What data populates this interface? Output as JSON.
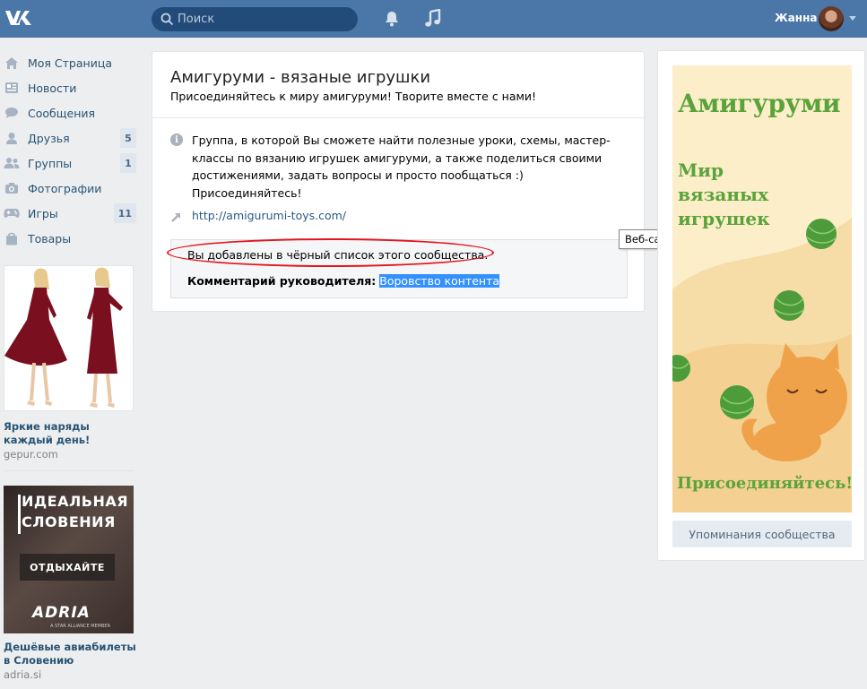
{
  "header": {
    "logo": "VK",
    "search_placeholder": "Поиск",
    "user_name": "Жанна"
  },
  "nav": {
    "items": [
      {
        "label": "Моя Страница",
        "icon": "home-icon"
      },
      {
        "label": "Новости",
        "icon": "news-icon"
      },
      {
        "label": "Сообщения",
        "icon": "messages-icon"
      },
      {
        "label": "Друзья",
        "icon": "friends-icon",
        "badge": "5"
      },
      {
        "label": "Группы",
        "icon": "groups-icon",
        "badge": "1"
      },
      {
        "label": "Фотографии",
        "icon": "camera-icon"
      },
      {
        "label": "Игры",
        "icon": "gamepad-icon",
        "badge": "11"
      },
      {
        "label": "Товары",
        "icon": "bag-icon"
      }
    ]
  },
  "ads": [
    {
      "title": "Яркие наряды каждый день!",
      "domain": "gepur.com"
    },
    {
      "title": "Дешёвые авиабилеты в Словению",
      "domain": "adria.si",
      "banner_line1": "ИДЕАЛЬНАЯ",
      "banner_line2": "СЛОВЕНИЯ",
      "banner_button": "ОТДЫХАЙТЕ",
      "banner_logo": "ADRIA",
      "banner_sub": "A STAR ALLIANCE MEMBER"
    }
  ],
  "group": {
    "title": "Амигуруми - вязаные игрушки",
    "status": "Присоединяйтесь к миру амигуруми! Творите вместе с нами!",
    "description": "Группа, в которой Вы сможете найти полезные уроки, схемы, мастер-классы по вязанию игрушек амигуруми, а также поделиться своими достижениями, задать вопросы и просто пообщаться :)",
    "description_2": "Присоединяйтесь!",
    "website": "http://amigurumi-toys.com/",
    "website_tooltip": "Веб-сайт",
    "blacklist_text": "Вы добавлены в чёрный список этого сообщества.",
    "comment_label": "Комментарий руководителя:",
    "comment_value": "Воровство контента"
  },
  "sidebar": {
    "cover_title": "Амигуруми",
    "cover_sub_1": "Мир",
    "cover_sub_2": "вязаных",
    "cover_sub_3": "игрушек",
    "cover_bottom": "Присоединяйтесь!",
    "mentions_button": "Упоминания сообщества"
  },
  "colors": {
    "header": "#4a76a8",
    "link": "#2a5885",
    "highlight": "#3390ff",
    "oval": "#e3151d",
    "cover_green": "#5aa33a"
  }
}
